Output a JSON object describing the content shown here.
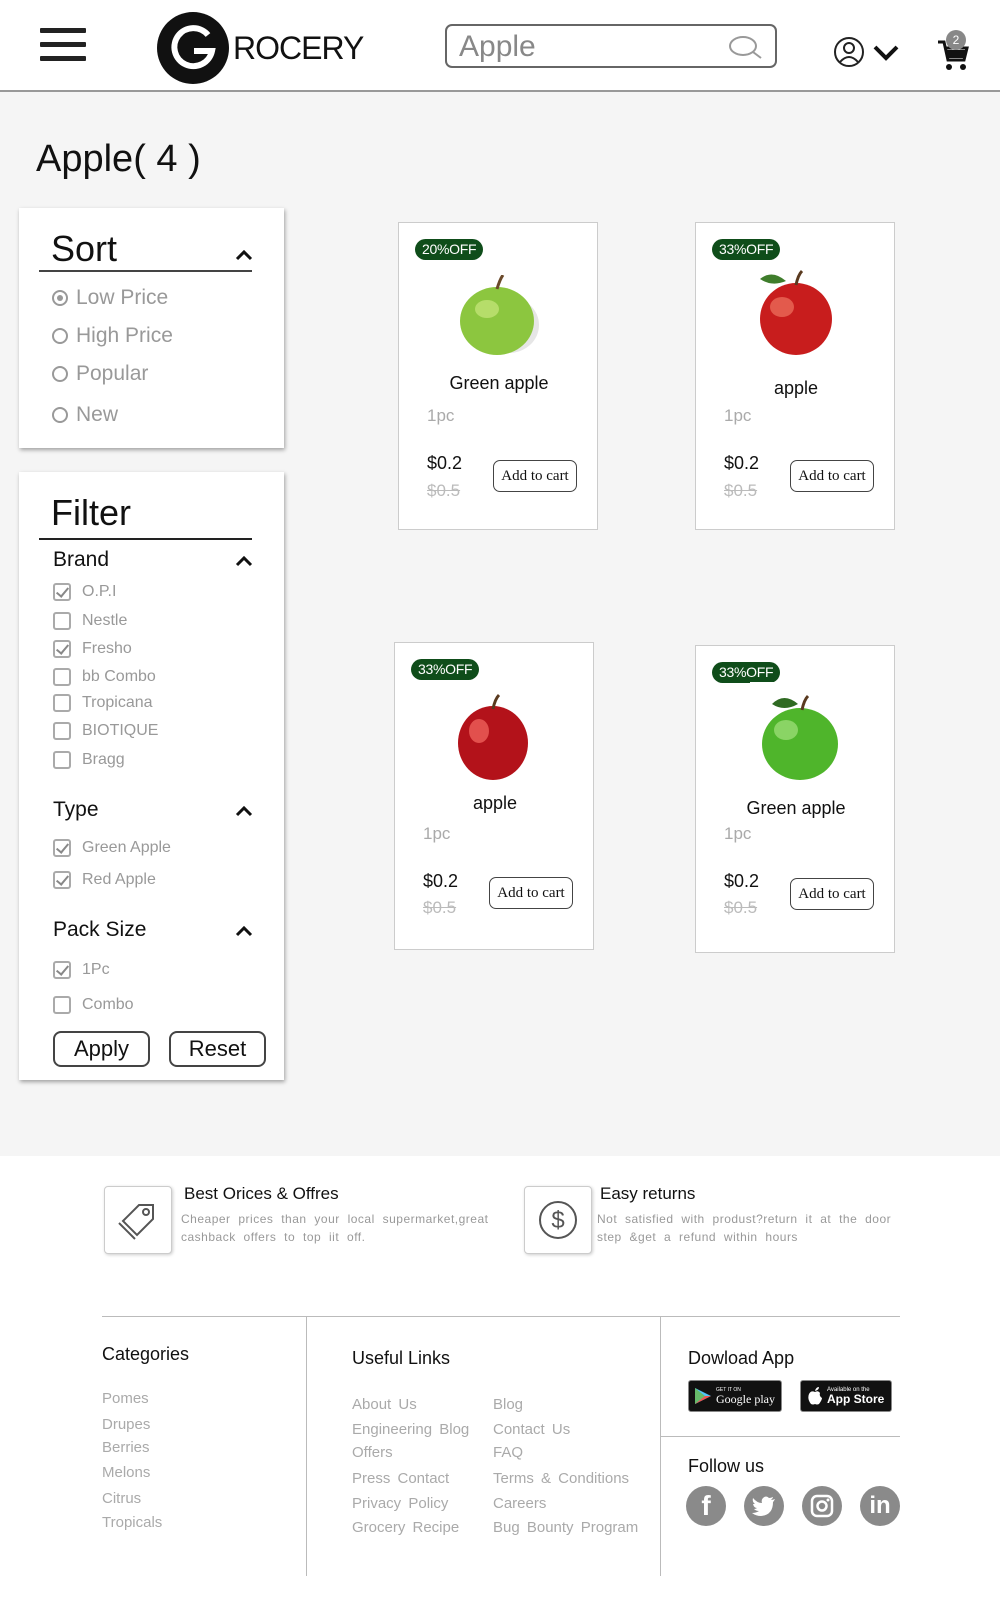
{
  "header": {
    "logo_text": "ROCERY",
    "search_value": "Apple",
    "cart_count": "2"
  },
  "page_title": "Apple( 4 )",
  "sort": {
    "title": "Sort",
    "options": [
      "Low  Price",
      "High  Price",
      "Popular",
      "New"
    ],
    "selected": "Low  Price"
  },
  "filter": {
    "title": "Filter",
    "brand": {
      "title": "Brand",
      "items": [
        {
          "label": "O.P.I",
          "checked": true
        },
        {
          "label": "Nestle",
          "checked": false
        },
        {
          "label": "Fresho",
          "checked": true
        },
        {
          "label": "bb  Combo",
          "checked": false
        },
        {
          "label": "Tropicana",
          "checked": false
        },
        {
          "label": "BIOTIQUE",
          "checked": false
        },
        {
          "label": "Bragg",
          "checked": false
        }
      ]
    },
    "type": {
      "title": "Type",
      "items": [
        {
          "label": "Green  Apple",
          "checked": true
        },
        {
          "label": "Red  Apple",
          "checked": true
        }
      ]
    },
    "pack": {
      "title": "Pack  Size",
      "items": [
        {
          "label": "1Pc",
          "checked": true
        },
        {
          "label": "Combo",
          "checked": false
        }
      ]
    },
    "apply_label": "Apply",
    "reset_label": "Reset"
  },
  "products": [
    {
      "badge": "20%OFF",
      "name": "Green  apple",
      "qty": "1pc",
      "price": "$0.2",
      "old_price": "$0.5",
      "cart_label": "Add to cart",
      "color": "green"
    },
    {
      "badge": "33%OFF",
      "name": "apple",
      "qty": "1pc",
      "price": "$0.2",
      "old_price": "$0.5",
      "cart_label": "Add to cart",
      "color": "red"
    },
    {
      "badge": "33%OFF",
      "name": "apple",
      "qty": "1pc",
      "price": "$0.2",
      "old_price": "$0.5",
      "cart_label": "Add to cart",
      "color": "red"
    },
    {
      "badge": "33%OFF",
      "name": "Green  apple",
      "qty": "1pc",
      "price": "$0.2",
      "old_price": "$0.5",
      "cart_label": "Add to cart",
      "color": "green"
    }
  ],
  "footer": {
    "features": [
      {
        "title": "Best  Orices  &  Offres",
        "text": "Cheaper  prices  than  your  local  supermarket,great cashback  offers  to  top  iit  off."
      },
      {
        "title": "Easy  returns",
        "text": "Not  satisfied  with  produst?return  it  at  the  door step  &get  a refund  within  hours"
      }
    ],
    "categories": {
      "title": "Categories",
      "items": [
        "Pomes",
        "Drupes",
        "Berries",
        "Melons",
        "Citrus",
        "Tropicals"
      ]
    },
    "useful_links": {
      "title": "Useful  Links",
      "col1": [
        "About  Us",
        "Engineering  Blog",
        "Offers",
        "Press  Contact",
        "Privacy  Policy",
        "Grocery  Recipe"
      ],
      "col2": [
        "Blog",
        "Contact  Us",
        "FAQ",
        "Terms  &  Conditions",
        "Careers",
        "Bug  Bounty  Program"
      ]
    },
    "download": {
      "title": "Dowload  App",
      "google_small": "GET IT ON",
      "google_big": "Google play",
      "apple_small": "Available on the",
      "apple_big": "App Store"
    },
    "follow": {
      "title": "Follow  us",
      "icons": [
        "facebook-icon",
        "twitter-icon",
        "instagram-icon",
        "linkedin-icon"
      ]
    }
  },
  "colors": {
    "badge_bg": "#0f4d1a",
    "page_bg": "#f5f5f5",
    "muted_text": "#999999"
  }
}
